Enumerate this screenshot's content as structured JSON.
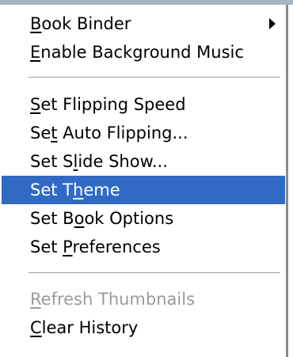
{
  "menu": {
    "items": [
      {
        "label": "Book Binder",
        "mnemonic_index": 0,
        "submenu": true,
        "submenu_icon": "submenu-arrow-icon"
      },
      {
        "label": "Enable Background Music",
        "mnemonic_index": 0
      },
      {
        "label": "Set Flipping Speed",
        "mnemonic_index": 0
      },
      {
        "label": "Set Auto Flipping...",
        "mnemonic_index": 2
      },
      {
        "label": "Set Slide Show...",
        "mnemonic_index": 5
      },
      {
        "label": "Set Theme",
        "mnemonic_index": 5,
        "selected": true
      },
      {
        "label": "Set Book Options",
        "mnemonic_index": 5
      },
      {
        "label": "Set Preferences",
        "mnemonic_index": 4
      },
      {
        "label": "Refresh Thumbnails",
        "mnemonic_index": 0,
        "disabled": true
      },
      {
        "label": "Clear History",
        "mnemonic_index": 0
      }
    ]
  },
  "colors": {
    "selection": "#316ac5",
    "disabled_text": "#9a9a9a",
    "separator": "#9c9c9c"
  }
}
